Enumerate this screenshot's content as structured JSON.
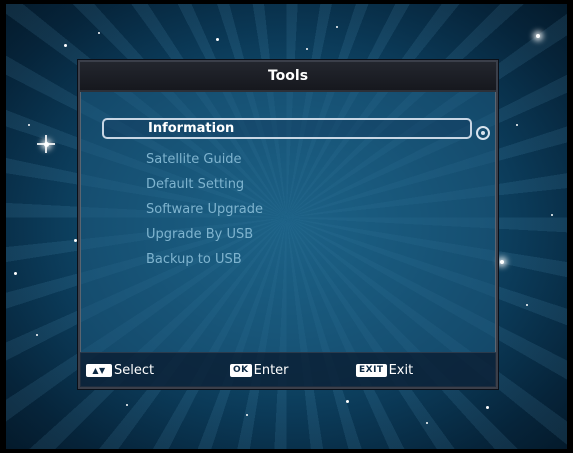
{
  "menu": {
    "title": "Tools",
    "items": [
      {
        "label": "Information",
        "selected": true
      },
      {
        "label": "Satellite Guide",
        "selected": false
      },
      {
        "label": "Default Setting",
        "selected": false
      },
      {
        "label": "Software Upgrade",
        "selected": false
      },
      {
        "label": "Upgrade By USB",
        "selected": false
      },
      {
        "label": "Backup to USB",
        "selected": false
      }
    ]
  },
  "footer": {
    "select": {
      "key": "▲▼",
      "label": "Select"
    },
    "enter": {
      "key": "OK",
      "label": "Enter"
    },
    "exit": {
      "key": "EXIT",
      "label": "Exit"
    }
  },
  "colors": {
    "highlight_border": "#c8d6e4",
    "item_text": "#7fb4cf",
    "selected_text": "#ffffff",
    "title_bar": "#1d2027"
  }
}
